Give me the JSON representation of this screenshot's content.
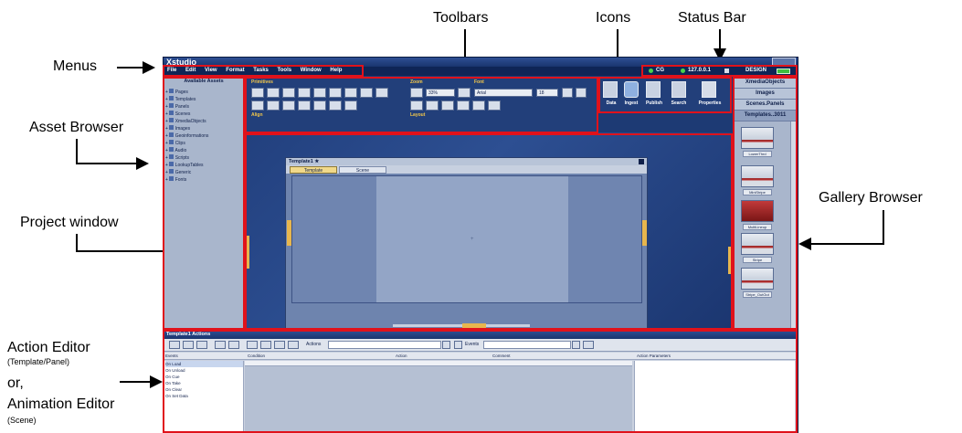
{
  "app": {
    "title": "Xstudio",
    "menus": [
      "File",
      "Edit",
      "View",
      "Format",
      "Tasks",
      "Tools",
      "Window",
      "Help"
    ],
    "status": {
      "item1": "CG",
      "item2": "127.0.0.1",
      "mode": "DESIGN"
    }
  },
  "callouts": {
    "menus": "Menus",
    "asset_browser": "Asset Browser",
    "project_window": "Project window",
    "toolbars": "Toolbars",
    "icons": "Icons",
    "status_bar": "Status Bar",
    "gallery_browser": "Gallery Browser",
    "action_editor": "Action Editor",
    "action_editor_sub": "(Template/Panel)",
    "or": "or,",
    "animation_editor": "Animation Editor",
    "animation_editor_sub": "(Scene)"
  },
  "assets": {
    "title": "Available Assets",
    "items": [
      "Pages",
      "Templates",
      "Panels",
      "Scenes",
      "XmediaObjects",
      "Images",
      "Geoinformations",
      "Clips",
      "Audio",
      "Scripts",
      "LookupTables",
      "Generic",
      "Fonts"
    ]
  },
  "toolbars": {
    "primitives": "Primitives",
    "align": "Align",
    "zoom": "Zoom",
    "zoom_value": "33%",
    "font": "Font",
    "font_value": "Arial",
    "font_size": "18",
    "layout": "Layout"
  },
  "icons": [
    "Data",
    "Ingest",
    "Publish",
    "Search",
    "Properties"
  ],
  "gallery": {
    "headers": [
      "XmediaObjects",
      "Images",
      "Scenes.Panels",
      "Templates..3011"
    ],
    "thumbs": [
      "LowerThrd",
      "MiniStripe",
      "MultiLineup",
      "Stripe",
      "Stripe_OutOut"
    ]
  },
  "project": {
    "title": "Template1 ★",
    "tabs": [
      "Template",
      "Scene"
    ]
  },
  "actions": {
    "title": "Template1 Actions",
    "actions_label": "Actions",
    "events_label": "Events",
    "columns": [
      "Events",
      "Condition",
      "Action",
      "Comment",
      "Action Parameters"
    ],
    "events": [
      "On Load",
      "On Unload",
      "On Cue",
      "On Take",
      "On Clear",
      "On Set Data"
    ]
  }
}
